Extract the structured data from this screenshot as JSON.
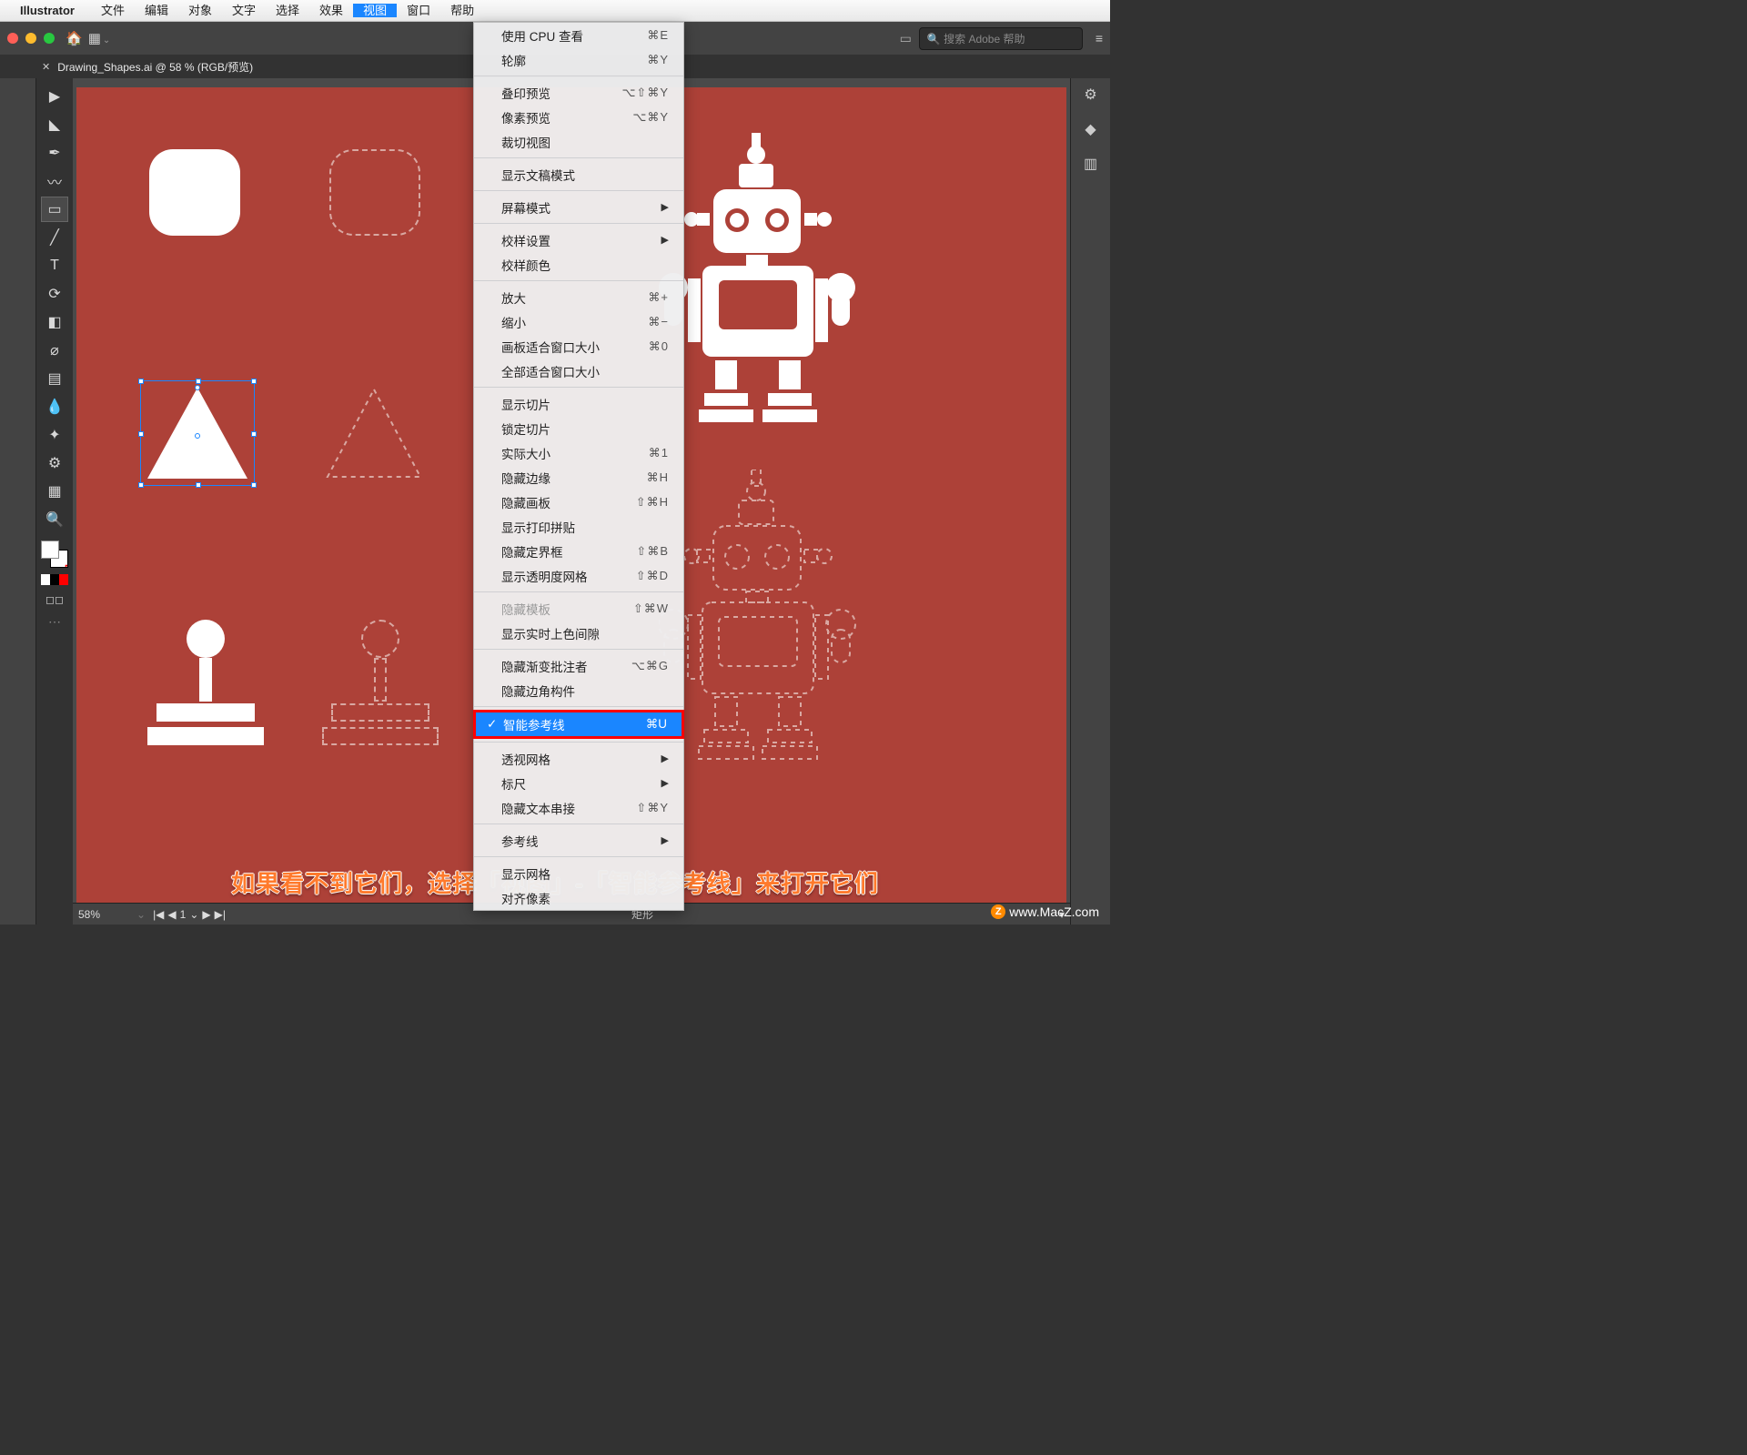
{
  "mac_menu": {
    "app_name": "Illustrator",
    "items": [
      "文件",
      "编辑",
      "对象",
      "文字",
      "选择",
      "效果",
      "视图",
      "窗口",
      "帮助"
    ],
    "active_index": 6
  },
  "toolbar": {
    "search_placeholder": "搜索 Adobe 帮助"
  },
  "document": {
    "tab_label": "Drawing_Shapes.ai @ 58 % (RGB/预览)"
  },
  "view_menu": {
    "groups": [
      [
        {
          "label": "使用 CPU 查看",
          "shortcut": "⌘E"
        },
        {
          "label": "轮廓",
          "shortcut": "⌘Y"
        }
      ],
      [
        {
          "label": "叠印预览",
          "shortcut": "⌥⇧⌘Y"
        },
        {
          "label": "像素预览",
          "shortcut": "⌥⌘Y"
        },
        {
          "label": "裁切视图",
          "shortcut": ""
        }
      ],
      [
        {
          "label": "显示文稿模式",
          "shortcut": ""
        }
      ],
      [
        {
          "label": "屏幕模式",
          "submenu": true
        }
      ],
      [
        {
          "label": "校样设置",
          "submenu": true
        },
        {
          "label": "校样颜色",
          "shortcut": ""
        }
      ],
      [
        {
          "label": "放大",
          "shortcut": "⌘+"
        },
        {
          "label": "缩小",
          "shortcut": "⌘−"
        },
        {
          "label": "画板适合窗口大小",
          "shortcut": "⌘0"
        },
        {
          "label": "全部适合窗口大小",
          "shortcut": ""
        }
      ],
      [
        {
          "label": "显示切片",
          "shortcut": ""
        },
        {
          "label": "锁定切片",
          "shortcut": ""
        },
        {
          "label": "实际大小",
          "shortcut": "⌘1"
        },
        {
          "label": "隐藏边缘",
          "shortcut": "⌘H"
        },
        {
          "label": "隐藏画板",
          "shortcut": "⇧⌘H"
        },
        {
          "label": "显示打印拼贴",
          "shortcut": ""
        },
        {
          "label": "隐藏定界框",
          "shortcut": "⇧⌘B"
        },
        {
          "label": "显示透明度网格",
          "shortcut": "⇧⌘D"
        }
      ],
      [
        {
          "label": "隐藏模板",
          "shortcut": "⇧⌘W",
          "disabled": true
        },
        {
          "label": "显示实时上色间隙",
          "shortcut": ""
        }
      ],
      [
        {
          "label": "隐藏渐变批注者",
          "shortcut": "⌥⌘G"
        },
        {
          "label": "隐藏边角构件",
          "shortcut": ""
        }
      ],
      [
        {
          "label": "智能参考线",
          "shortcut": "⌘U",
          "checked": true,
          "highlight": true
        }
      ],
      [
        {
          "label": "透视网格",
          "submenu": true
        },
        {
          "label": "标尺",
          "submenu": true
        },
        {
          "label": "隐藏文本串接",
          "shortcut": "⇧⌘Y"
        }
      ],
      [
        {
          "label": "参考线",
          "submenu": true
        }
      ],
      [
        {
          "label": "显示网格",
          "shortcut": ""
        },
        {
          "label": "对齐像素",
          "shortcut": ""
        }
      ]
    ]
  },
  "status": {
    "zoom": "58%",
    "artboard_num": "1",
    "shape": "矩形"
  },
  "tools": {
    "names": [
      "selection-tool",
      "direct-selection-tool",
      "pen-tool",
      "curvature-tool",
      "rectangle-tool",
      "paintbrush-tool",
      "type-tool",
      "rotate-tool",
      "eraser-tool",
      "shape-builder-tool",
      "gradient-tool",
      "eyedropper-tool",
      "blend-tool",
      "symbol-sprayer-tool",
      "artboard-tool",
      "zoom-tool"
    ],
    "glyphs": [
      "▶",
      "◣",
      "✒",
      "〰",
      "▭",
      "╱",
      "T",
      "⟳",
      "◧",
      "⌀",
      "▤",
      "💧",
      "✦",
      "⚙",
      "▦",
      "🔍"
    ],
    "selected_index": 4
  },
  "right_panel": {
    "icons": [
      "properties-icon",
      "layers-icon",
      "libraries-icon"
    ],
    "glyphs": [
      "⚙",
      "◆",
      "▥"
    ]
  },
  "caption": "如果看不到它们，选择「视图」-「智能参考线」来打开它们",
  "watermark": "www.MacZ.com"
}
